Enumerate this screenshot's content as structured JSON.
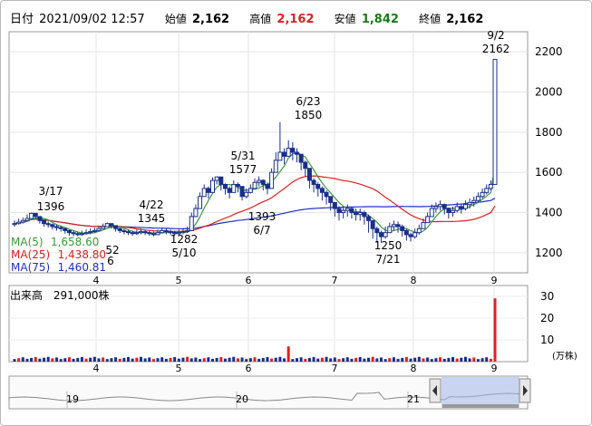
{
  "header": {
    "date_label": "日付",
    "date_value": "2021/09/02 12:57",
    "open_label": "始値",
    "open_value": "2,162",
    "high_label": "高値",
    "high_value": "2,162",
    "low_label": "安値",
    "low_value": "1,842",
    "close_label": "終値",
    "close_value": "2,162"
  },
  "colors": {
    "high": "#e02020",
    "low": "#1a7a1a",
    "candle": "#1a2f8a",
    "ma5": "#3a9a3a",
    "ma25": "#e02020",
    "ma75": "#2030c0",
    "volume_bar": "#1a2f8a",
    "volume_spike": "#e02020"
  },
  "ma_legend": [
    {
      "label": "MA(5)",
      "value": "1,658.60",
      "color": "#3a9a3a"
    },
    {
      "label": "MA(25)",
      "value": "1,438.80",
      "color": "#e02020"
    },
    {
      "label": "MA(75)",
      "value": "1,460.81",
      "color": "#2030c0"
    }
  ],
  "volume": {
    "label": "出来高",
    "value": "291,000株",
    "unit": "(万株)",
    "yticks": [
      "10",
      "20",
      "30"
    ]
  },
  "navigator": {
    "month_labels": [
      "19",
      "20",
      "21"
    ]
  },
  "chart_data": {
    "type": "candlestick",
    "price_axis": {
      "ticks": [
        1200,
        1400,
        1600,
        1800,
        2000,
        2200
      ],
      "ylim": [
        1100,
        2300
      ]
    },
    "month_ticks": [
      "4",
      "5",
      "6",
      "7",
      "8",
      "9"
    ],
    "annotations": [
      {
        "date": "3/17",
        "price": "1396"
      },
      {
        "date": "4/22",
        "price": "1345"
      },
      {
        "date": "5/10",
        "price": "1282"
      },
      {
        "date": "5/31",
        "price": "1577"
      },
      {
        "date": "6/7",
        "price": "1393"
      },
      {
        "date": "6/23",
        "price": "1850"
      },
      {
        "date": "7/21",
        "price": "1250"
      },
      {
        "date": "9/2",
        "price": "2162"
      }
    ],
    "partial_label": "52",
    "partial_label_2": "6",
    "closes": [
      1345,
      1352,
      1360,
      1370,
      1396,
      1380,
      1360,
      1345,
      1340,
      1330,
      1325,
      1320,
      1310,
      1300,
      1295,
      1290,
      1295,
      1300,
      1305,
      1310,
      1320,
      1330,
      1345,
      1335,
      1320,
      1310,
      1305,
      1300,
      1295,
      1300,
      1305,
      1300,
      1295,
      1290,
      1300,
      1310,
      1305,
      1300,
      1295,
      1300,
      1305,
      1310,
      1380,
      1420,
      1480,
      1520,
      1500,
      1560,
      1577,
      1540,
      1520,
      1500,
      1540,
      1530,
      1480,
      1500,
      1520,
      1550,
      1560,
      1540,
      1520,
      1600,
      1660,
      1700,
      1680,
      1720,
      1700,
      1690,
      1650,
      1620,
      1560,
      1540,
      1520,
      1500,
      1480,
      1450,
      1420,
      1400,
      1410,
      1420,
      1400,
      1390,
      1400,
      1380,
      1360,
      1320,
      1300,
      1280,
      1300,
      1330,
      1340,
      1330,
      1310,
      1290,
      1280,
      1300,
      1320,
      1350,
      1380,
      1420,
      1430,
      1440,
      1420,
      1400,
      1410,
      1430,
      1420,
      1440,
      1450,
      1460,
      1480,
      1500,
      1520,
      1540,
      2162
    ],
    "highs": [
      1360,
      1370,
      1375,
      1390,
      1400,
      1395,
      1380,
      1360,
      1355,
      1345,
      1340,
      1335,
      1325,
      1315,
      1310,
      1305,
      1310,
      1315,
      1320,
      1325,
      1335,
      1345,
      1350,
      1345,
      1335,
      1325,
      1320,
      1315,
      1310,
      1315,
      1320,
      1315,
      1310,
      1305,
      1315,
      1325,
      1320,
      1315,
      1310,
      1315,
      1320,
      1330,
      1400,
      1440,
      1500,
      1540,
      1530,
      1575,
      1580,
      1560,
      1545,
      1530,
      1560,
      1550,
      1510,
      1520,
      1540,
      1570,
      1580,
      1565,
      1550,
      1620,
      1700,
      1850,
      1720,
      1760,
      1750,
      1720,
      1690,
      1660,
      1600,
      1570,
      1550,
      1530,
      1510,
      1480,
      1450,
      1430,
      1430,
      1440,
      1430,
      1420,
      1420,
      1410,
      1390,
      1360,
      1330,
      1310,
      1330,
      1350,
      1360,
      1355,
      1340,
      1320,
      1300,
      1320,
      1340,
      1370,
      1400,
      1440,
      1450,
      1460,
      1445,
      1425,
      1430,
      1450,
      1445,
      1460,
      1470,
      1480,
      1500,
      1520,
      1540,
      1560,
      2162
    ],
    "lows": [
      1330,
      1340,
      1345,
      1355,
      1375,
      1365,
      1345,
      1330,
      1325,
      1315,
      1310,
      1305,
      1295,
      1285,
      1282,
      1282,
      1285,
      1290,
      1292,
      1298,
      1305,
      1318,
      1330,
      1320,
      1305,
      1298,
      1292,
      1288,
      1284,
      1288,
      1292,
      1288,
      1284,
      1282,
      1288,
      1296,
      1292,
      1288,
      1284,
      1288,
      1292,
      1298,
      1330,
      1393,
      1440,
      1480,
      1470,
      1520,
      1540,
      1510,
      1490,
      1470,
      1500,
      1500,
      1460,
      1470,
      1495,
      1520,
      1530,
      1510,
      1490,
      1560,
      1620,
      1660,
      1640,
      1680,
      1660,
      1650,
      1610,
      1580,
      1520,
      1500,
      1480,
      1460,
      1440,
      1410,
      1380,
      1360,
      1370,
      1380,
      1370,
      1360,
      1360,
      1340,
      1300,
      1270,
      1250,
      1250,
      1270,
      1300,
      1310,
      1300,
      1280,
      1260,
      1255,
      1270,
      1290,
      1320,
      1350,
      1390,
      1400,
      1410,
      1390,
      1370,
      1380,
      1400,
      1395,
      1410,
      1420,
      1430,
      1450,
      1470,
      1490,
      1510,
      1842
    ]
  }
}
